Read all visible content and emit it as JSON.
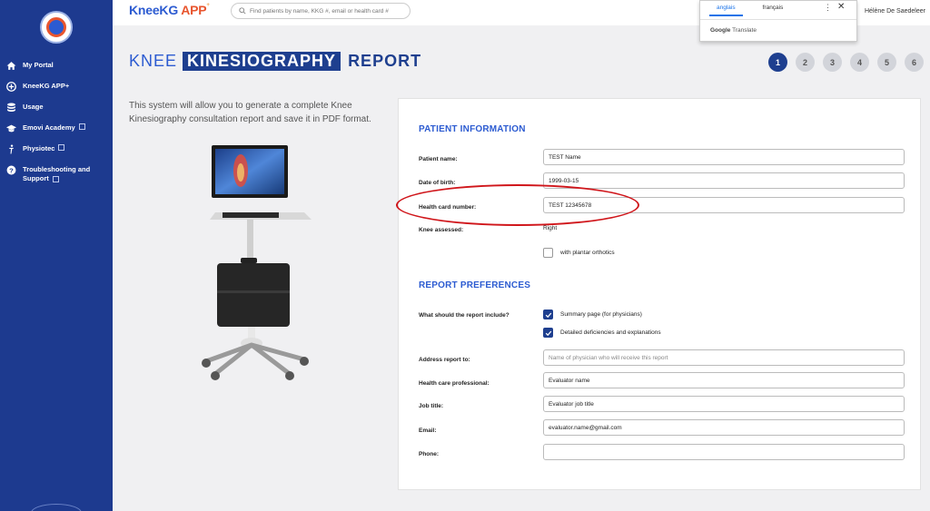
{
  "sidebar": {
    "items": [
      {
        "label": "My Portal",
        "icon": "home-icon",
        "external": false
      },
      {
        "label": "KneeKG APP+",
        "icon": "plus-circle-icon",
        "external": false
      },
      {
        "label": "Usage",
        "icon": "database-icon",
        "external": false
      },
      {
        "label": "Emovi Academy",
        "icon": "graduation-cap-icon",
        "external": true
      },
      {
        "label": "Physiotec",
        "icon": "figure-icon",
        "external": true
      },
      {
        "label": "Troubleshooting and Support",
        "icon": "question-circle-icon",
        "external": true
      }
    ]
  },
  "header": {
    "brand_main": "KneeKG",
    "brand_app": "APP",
    "brand_sup": "+",
    "search_placeholder": "Find patients by name, KKG #, email or health card #",
    "user_name": "Hélène De Saedeleer"
  },
  "translate": {
    "tabs": [
      "anglais",
      "français"
    ],
    "active_tab": "anglais",
    "more": "⋮",
    "close": "✕",
    "logo_google": "Google",
    "logo_translate": "Translate"
  },
  "page": {
    "title_word1": "KNEE",
    "title_word2": "KINESIOGRAPHY",
    "title_word3": "REPORT",
    "steps": [
      "1",
      "2",
      "3",
      "4",
      "5",
      "6"
    ],
    "active_step": "1",
    "intro": "This system will allow you to generate a complete Knee Kinesiography consultation report and save it in PDF format."
  },
  "form": {
    "patient_section": "PATIENT INFORMATION",
    "patient_name_label": "Patient name:",
    "patient_name_value": "TEST Name",
    "dob_label": "Date of birth:",
    "dob_value": "1999-03-15",
    "health_card_label": "Health card number:",
    "health_card_value": "TEST 12345678",
    "knee_label": "Knee assessed:",
    "knee_value": "Right",
    "orthotics_label": "with plantar orthotics",
    "orthotics_checked": false,
    "prefs_section": "REPORT PREFERENCES",
    "include_label": "What should the report include?",
    "include_summary": "Summary page (for physicians)",
    "include_summary_checked": true,
    "include_detailed": "Detailed deficiencies and explanations",
    "include_detailed_checked": true,
    "address_label": "Address report to:",
    "address_placeholder": "Name of physician who will receive this report",
    "hcp_label": "Health care professional:",
    "hcp_value": "Evaluator name",
    "job_label": "Job title:",
    "job_value": "Evaluator job title",
    "email_label": "Email:",
    "email_value": "evaluator.name@gmail.com",
    "phone_label": "Phone:",
    "phone_value": ""
  },
  "colors": {
    "sidebar": "#1d3a8f",
    "accent": "#2c5bd1",
    "brand_orange": "#e8552e",
    "annotation": "#d0161b"
  }
}
